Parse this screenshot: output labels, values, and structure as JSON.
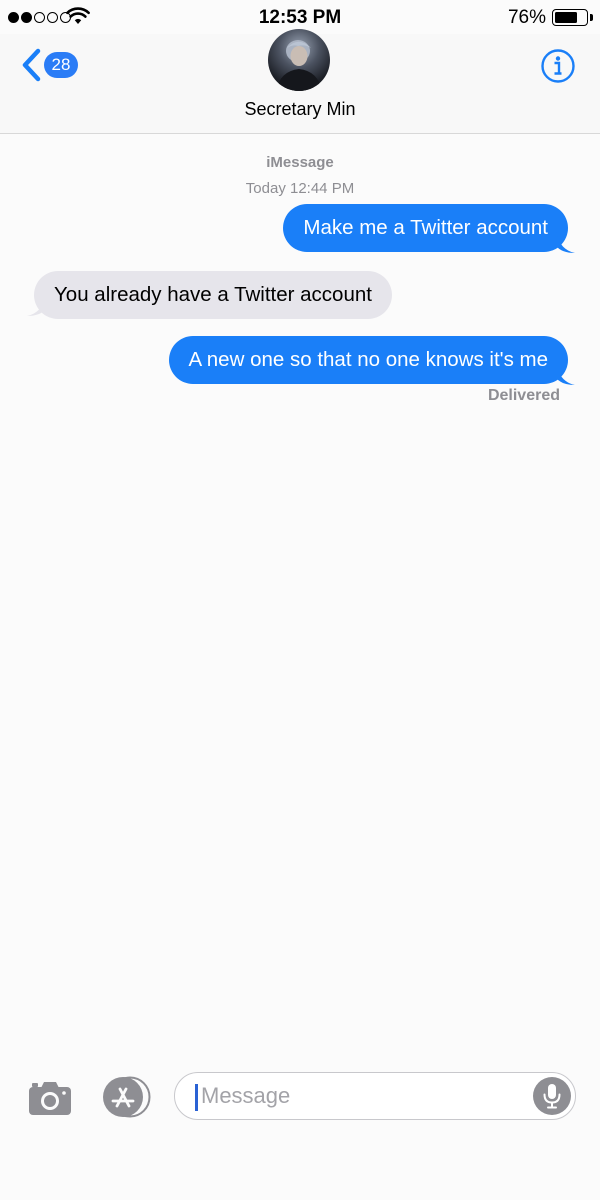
{
  "status_bar": {
    "signal_filled": 2,
    "signal_total": 5,
    "time": "12:53 PM",
    "battery_percent_text": "76%",
    "battery_level": 0.76
  },
  "nav": {
    "back_badge_count": "28",
    "contact_name": "Secretary Min"
  },
  "conversation": {
    "service_label": "iMessage",
    "timestamp": "Today 12:44 PM",
    "messages": [
      {
        "direction": "outgoing",
        "text": "Make me a Twitter account"
      },
      {
        "direction": "incoming",
        "text": "You already have a Twitter account"
      },
      {
        "direction": "outgoing",
        "text": "A new one so that no one knows it's me"
      }
    ],
    "delivery_status": "Delivered"
  },
  "input_bar": {
    "placeholder": "Message"
  },
  "colors": {
    "accent": "#1a7ff8",
    "incoming_bubble": "#e6e5eb",
    "secondary_text": "#8e8e93"
  },
  "icons": [
    "back-chevron-icon",
    "info-icon",
    "camera-icon",
    "app-store-icon",
    "microphone-icon",
    "wifi-icon",
    "battery-icon"
  ]
}
